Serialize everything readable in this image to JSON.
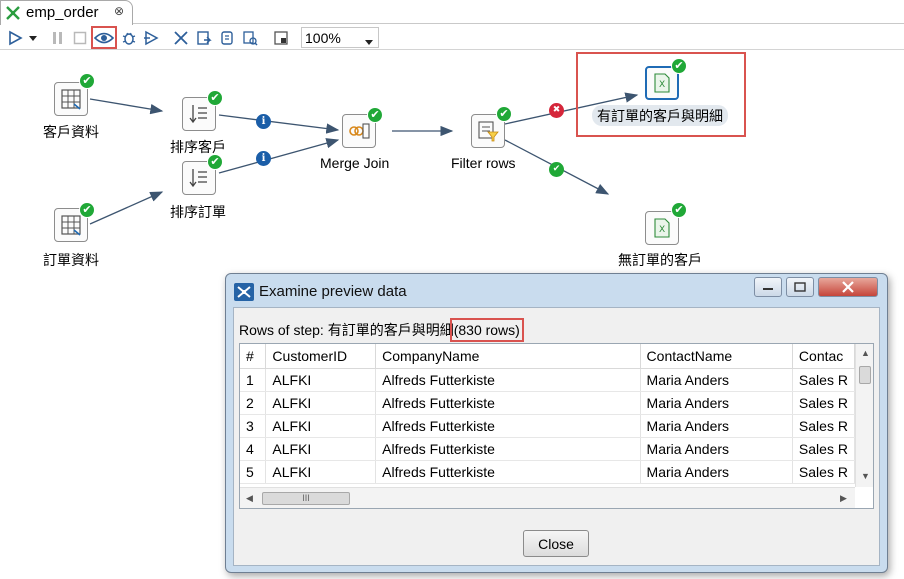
{
  "tab": {
    "title": "emp_order",
    "close_glyph": "⊗"
  },
  "toolbar": {
    "zoom": "100%",
    "buttons": [
      "run-icon",
      "run-dropdown-icon",
      "pause-icon",
      "stop-icon",
      "preview-icon",
      "debug-icon",
      "replay-icon",
      "verify-icon",
      "analyze-impact-icon",
      "sql-icon",
      "explore-db-icon",
      "show-results-icon"
    ]
  },
  "canvas": {
    "steps": {
      "customers": "客戶資料",
      "orders": "訂單資料",
      "sort_customers": "排序客戶",
      "sort_orders": "排序訂單",
      "merge_join": "Merge Join",
      "filter_rows": "Filter rows",
      "with_orders": "有訂單的客戶與明細",
      "no_orders": "無訂單的客戶"
    },
    "hop_icons": {
      "info": "i",
      "error": "✖",
      "ok": "✔"
    }
  },
  "dialog": {
    "title": "Examine preview data",
    "rows_prefix": "Rows of step: ",
    "step_name": "有訂單的客戶與明細",
    "row_count": "(830 rows)",
    "columns": [
      "#",
      "CustomerID",
      "CompanyName",
      "ContactName",
      "Contac"
    ],
    "rows": [
      [
        "1",
        "ALFKI",
        "Alfreds Futterkiste",
        "Maria Anders",
        "Sales R"
      ],
      [
        "2",
        "ALFKI",
        "Alfreds Futterkiste",
        "Maria Anders",
        "Sales R"
      ],
      [
        "3",
        "ALFKI",
        "Alfreds Futterkiste",
        "Maria Anders",
        "Sales R"
      ],
      [
        "4",
        "ALFKI",
        "Alfreds Futterkiste",
        "Maria Anders",
        "Sales R"
      ],
      [
        "5",
        "ALFKI",
        "Alfreds Futterkiste",
        "Maria Anders",
        "Sales R"
      ]
    ],
    "close_label": "Close",
    "hscroll_grip": "III"
  },
  "colors": {
    "highlight": "#d9534f",
    "ok": "#20a837",
    "error": "#d5263a",
    "info": "#1b5ea8",
    "selected": "#1f6bb5"
  }
}
